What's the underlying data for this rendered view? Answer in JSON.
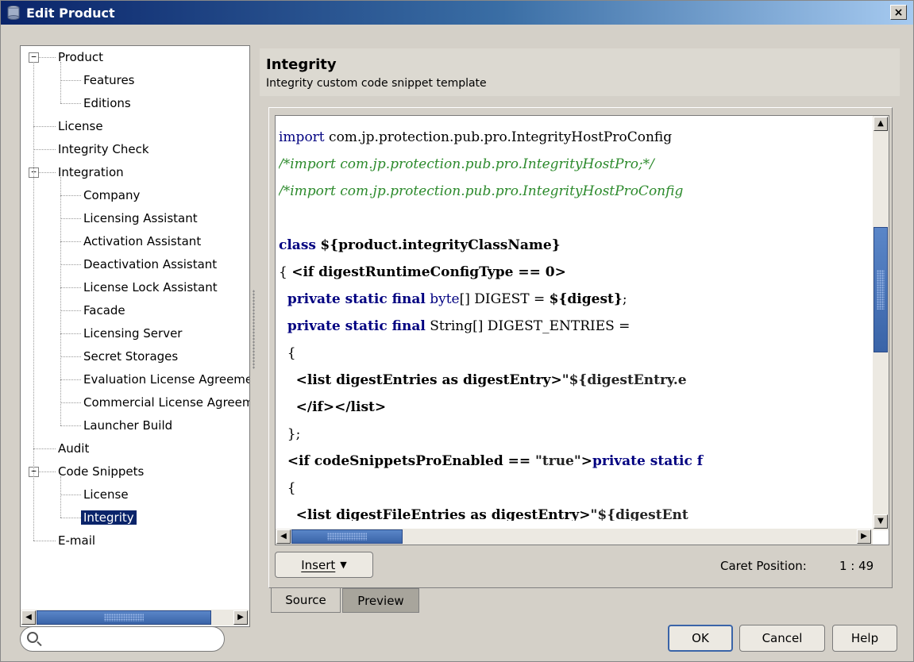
{
  "window": {
    "title": "Edit Product",
    "close_label": "×"
  },
  "tree": {
    "items": [
      {
        "label": "Product",
        "expander": "−"
      },
      {
        "label": "Features"
      },
      {
        "label": "Editions"
      },
      {
        "label": "License"
      },
      {
        "label": "Integrity Check"
      },
      {
        "label": "Integration",
        "expander": "−"
      },
      {
        "label": "Company"
      },
      {
        "label": "Licensing Assistant"
      },
      {
        "label": "Activation Assistant"
      },
      {
        "label": "Deactivation Assistant"
      },
      {
        "label": "License Lock Assistant"
      },
      {
        "label": "Facade"
      },
      {
        "label": "Licensing Server"
      },
      {
        "label": "Secret Storages"
      },
      {
        "label": "Evaluation License Agreement"
      },
      {
        "label": "Commercial License Agreement"
      },
      {
        "label": "Launcher Build"
      },
      {
        "label": "Audit"
      },
      {
        "label": "Code Snippets",
        "expander": "−"
      },
      {
        "label": "License"
      },
      {
        "label": "Integrity",
        "selected": true
      },
      {
        "label": "E-mail"
      }
    ]
  },
  "search": {
    "placeholder": ""
  },
  "header": {
    "title": "Integrity",
    "subtitle": "Integrity custom code snippet template"
  },
  "editor": {
    "lines": [
      "import com.jp.protection.pub.pro.IntegrityHostProConfig",
      "/*import com.jp.protection.pub.pro.IntegrityHostPro;*/",
      "/*import com.jp.protection.pub.pro.IntegrityHostProConfig",
      "",
      "class ${product.integrityClassName}",
      "{ <if digestRuntimeConfigType == 0>",
      "  private static final byte[] DIGEST = ${digest};",
      "  private static final String[] DIGEST_ENTRIES =",
      "  {",
      "    <list digestEntries as digestEntry>\"${digestEntry.e",
      "    </if></list>",
      "  };",
      "  <if codeSnippetsProEnabled == \"true\">private static f",
      "  {",
      "    <list digestFileEntries as digestEntry>\"${digestEnt"
    ]
  },
  "toolbar": {
    "insert_label": "Insert",
    "insert_arrow": "▼",
    "caret_label": "Caret Position:",
    "caret_value": "1 : 49"
  },
  "tabs": {
    "source": "Source",
    "preview": "Preview"
  },
  "buttons": {
    "ok": "OK",
    "cancel": "Cancel",
    "help": "Help"
  },
  "colors": {
    "selection": "#0a246a",
    "keyword": "#000080",
    "comment": "#2c8a2c",
    "scroll_thumb": "#3a64a8"
  }
}
